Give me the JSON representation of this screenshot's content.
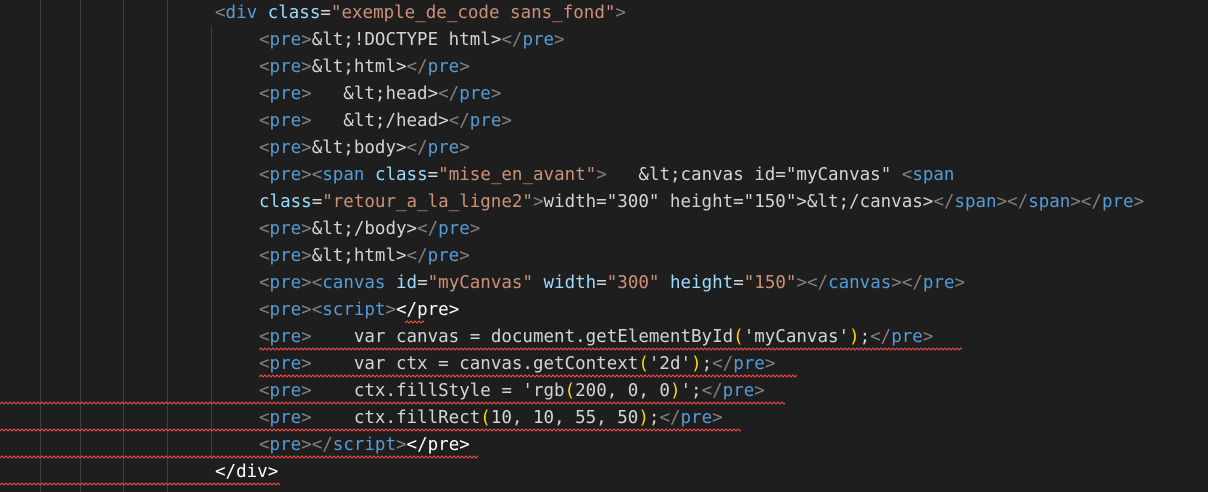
{
  "lines": [
    {
      "indent": 215,
      "tokens": [
        {
          "t": "<",
          "c": "br"
        },
        {
          "t": "div",
          "c": "tag"
        },
        {
          "t": " class",
          "c": "attr"
        },
        {
          "t": "=",
          "c": "txt"
        },
        {
          "t": "\"exemple_de_code sans_fond\"",
          "c": "str"
        },
        {
          "t": ">",
          "c": "br"
        }
      ]
    },
    {
      "indent": 259,
      "tokens": [
        {
          "t": "<",
          "c": "br"
        },
        {
          "t": "pre",
          "c": "tag"
        },
        {
          "t": ">",
          "c": "br"
        },
        {
          "t": "&lt;!DOCTYPE html>",
          "c": "txt"
        },
        {
          "t": "</",
          "c": "br"
        },
        {
          "t": "pre",
          "c": "tag"
        },
        {
          "t": ">",
          "c": "br"
        }
      ]
    },
    {
      "indent": 259,
      "tokens": [
        {
          "t": "<",
          "c": "br"
        },
        {
          "t": "pre",
          "c": "tag"
        },
        {
          "t": ">",
          "c": "br"
        },
        {
          "t": "&lt;html>",
          "c": "txt"
        },
        {
          "t": "</",
          "c": "br"
        },
        {
          "t": "pre",
          "c": "tag"
        },
        {
          "t": ">",
          "c": "br"
        }
      ]
    },
    {
      "indent": 259,
      "tokens": [
        {
          "t": "<",
          "c": "br"
        },
        {
          "t": "pre",
          "c": "tag"
        },
        {
          "t": ">",
          "c": "br"
        },
        {
          "t": "   &lt;head>",
          "c": "txt"
        },
        {
          "t": "</",
          "c": "br"
        },
        {
          "t": "pre",
          "c": "tag"
        },
        {
          "t": ">",
          "c": "br"
        }
      ]
    },
    {
      "indent": 259,
      "tokens": [
        {
          "t": "<",
          "c": "br"
        },
        {
          "t": "pre",
          "c": "tag"
        },
        {
          "t": ">",
          "c": "br"
        },
        {
          "t": "   &lt;/head>",
          "c": "txt"
        },
        {
          "t": "</",
          "c": "br"
        },
        {
          "t": "pre",
          "c": "tag"
        },
        {
          "t": ">",
          "c": "br"
        }
      ]
    },
    {
      "indent": 259,
      "tokens": [
        {
          "t": "<",
          "c": "br"
        },
        {
          "t": "pre",
          "c": "tag"
        },
        {
          "t": ">",
          "c": "br"
        },
        {
          "t": "&lt;body>",
          "c": "txt"
        },
        {
          "t": "</",
          "c": "br"
        },
        {
          "t": "pre",
          "c": "tag"
        },
        {
          "t": ">",
          "c": "br"
        }
      ]
    },
    {
      "indent": 259,
      "tokens": [
        {
          "t": "<",
          "c": "br"
        },
        {
          "t": "pre",
          "c": "tag"
        },
        {
          "t": ">",
          "c": "br"
        },
        {
          "t": "<",
          "c": "br"
        },
        {
          "t": "span",
          "c": "tag"
        },
        {
          "t": " class",
          "c": "attr"
        },
        {
          "t": "=",
          "c": "txt"
        },
        {
          "t": "\"mise_en_avant\"",
          "c": "str"
        },
        {
          "t": ">",
          "c": "br"
        },
        {
          "t": "   &lt;canvas id=\"myCanvas\" ",
          "c": "txt"
        },
        {
          "t": "<",
          "c": "br"
        },
        {
          "t": "span",
          "c": "tag"
        }
      ]
    },
    {
      "indent": 259,
      "tokens": [
        {
          "t": "class",
          "c": "attr"
        },
        {
          "t": "=",
          "c": "txt"
        },
        {
          "t": "\"retour_a_la_ligne2\"",
          "c": "str"
        },
        {
          "t": ">",
          "c": "br"
        },
        {
          "t": "width=\"300\" height=\"150\">&lt;/canvas>",
          "c": "txt"
        },
        {
          "t": "</",
          "c": "br"
        },
        {
          "t": "span",
          "c": "tag"
        },
        {
          "t": ">",
          "c": "br"
        },
        {
          "t": "</",
          "c": "br"
        },
        {
          "t": "span",
          "c": "tag"
        },
        {
          "t": ">",
          "c": "br"
        },
        {
          "t": "</",
          "c": "br"
        },
        {
          "t": "pre",
          "c": "tag"
        },
        {
          "t": ">",
          "c": "br"
        }
      ]
    },
    {
      "indent": 259,
      "tokens": [
        {
          "t": "<",
          "c": "br"
        },
        {
          "t": "pre",
          "c": "tag"
        },
        {
          "t": ">",
          "c": "br"
        },
        {
          "t": "&lt;/body>",
          "c": "txt"
        },
        {
          "t": "</",
          "c": "br"
        },
        {
          "t": "pre",
          "c": "tag"
        },
        {
          "t": ">",
          "c": "br"
        }
      ]
    },
    {
      "indent": 259,
      "tokens": [
        {
          "t": "<",
          "c": "br"
        },
        {
          "t": "pre",
          "c": "tag"
        },
        {
          "t": ">",
          "c": "br"
        },
        {
          "t": "&lt;html>",
          "c": "txt"
        },
        {
          "t": "</",
          "c": "br"
        },
        {
          "t": "pre",
          "c": "tag"
        },
        {
          "t": ">",
          "c": "br"
        }
      ]
    },
    {
      "indent": 259,
      "tokens": [
        {
          "t": "<",
          "c": "br"
        },
        {
          "t": "pre",
          "c": "tag"
        },
        {
          "t": ">",
          "c": "br"
        },
        {
          "t": "<",
          "c": "br"
        },
        {
          "t": "canvas",
          "c": "tag"
        },
        {
          "t": " id",
          "c": "attr"
        },
        {
          "t": "=",
          "c": "txt"
        },
        {
          "t": "\"myCanvas\"",
          "c": "str"
        },
        {
          "t": " width",
          "c": "attr"
        },
        {
          "t": "=",
          "c": "txt"
        },
        {
          "t": "\"300\"",
          "c": "str"
        },
        {
          "t": " height",
          "c": "attr"
        },
        {
          "t": "=",
          "c": "txt"
        },
        {
          "t": "\"150\"",
          "c": "str"
        },
        {
          "t": ">",
          "c": "br"
        },
        {
          "t": "</",
          "c": "br"
        },
        {
          "t": "canvas",
          "c": "tag"
        },
        {
          "t": ">",
          "c": "br"
        },
        {
          "t": "</",
          "c": "br"
        },
        {
          "t": "pre",
          "c": "tag"
        },
        {
          "t": ">",
          "c": "br"
        }
      ]
    },
    {
      "indent": 259,
      "tokens": [
        {
          "t": "<",
          "c": "br"
        },
        {
          "t": "pre",
          "c": "tag"
        },
        {
          "t": ">",
          "c": "br"
        },
        {
          "t": "<",
          "c": "br"
        },
        {
          "t": "script",
          "c": "tag"
        },
        {
          "t": ">",
          "c": "br"
        },
        {
          "t": "</",
          "c": "wht"
        },
        {
          "t": "pre",
          "c": "wht"
        },
        {
          "t": ">",
          "c": "wht"
        }
      ]
    },
    {
      "indent": 259,
      "tokens": [
        {
          "t": "<",
          "c": "br"
        },
        {
          "t": "pre",
          "c": "tag"
        },
        {
          "t": ">",
          "c": "br"
        },
        {
          "t": "    var canvas = document.getElementById",
          "c": "txt"
        },
        {
          "t": "(",
          "c": "par"
        },
        {
          "t": "'myCanvas'",
          "c": "txt"
        },
        {
          "t": ")",
          "c": "par"
        },
        {
          "t": ";",
          "c": "txt"
        },
        {
          "t": "</",
          "c": "br"
        },
        {
          "t": "pre",
          "c": "tag"
        },
        {
          "t": ">",
          "c": "br"
        }
      ]
    },
    {
      "indent": 259,
      "tokens": [
        {
          "t": "<",
          "c": "br"
        },
        {
          "t": "pre",
          "c": "tag"
        },
        {
          "t": ">",
          "c": "br"
        },
        {
          "t": "    var ctx = canvas.getContext",
          "c": "txt"
        },
        {
          "t": "(",
          "c": "par"
        },
        {
          "t": "'2d'",
          "c": "txt"
        },
        {
          "t": ")",
          "c": "par"
        },
        {
          "t": ";",
          "c": "txt"
        },
        {
          "t": "</",
          "c": "br"
        },
        {
          "t": "pre",
          "c": "tag"
        },
        {
          "t": ">",
          "c": "br"
        }
      ]
    },
    {
      "indent": 259,
      "tokens": [
        {
          "t": "<",
          "c": "br"
        },
        {
          "t": "pre",
          "c": "tag"
        },
        {
          "t": ">",
          "c": "br"
        },
        {
          "t": "    ctx.fillStyle = 'rgb",
          "c": "txt"
        },
        {
          "t": "(",
          "c": "par"
        },
        {
          "t": "200, 0, 0",
          "c": "txt"
        },
        {
          "t": ")",
          "c": "par"
        },
        {
          "t": "';",
          "c": "txt"
        },
        {
          "t": "</",
          "c": "br"
        },
        {
          "t": "pre",
          "c": "tag"
        },
        {
          "t": ">",
          "c": "br"
        }
      ]
    },
    {
      "indent": 259,
      "tokens": [
        {
          "t": "<",
          "c": "br"
        },
        {
          "t": "pre",
          "c": "tag"
        },
        {
          "t": ">",
          "c": "br"
        },
        {
          "t": "    ctx.fillRect",
          "c": "txt"
        },
        {
          "t": "(",
          "c": "par"
        },
        {
          "t": "10, 10, 55, 50",
          "c": "txt"
        },
        {
          "t": ")",
          "c": "par"
        },
        {
          "t": ";",
          "c": "txt"
        },
        {
          "t": "</",
          "c": "br"
        },
        {
          "t": "pre",
          "c": "tag"
        },
        {
          "t": ">",
          "c": "br"
        }
      ]
    },
    {
      "indent": 259,
      "tokens": [
        {
          "t": "<",
          "c": "br"
        },
        {
          "t": "pre",
          "c": "tag"
        },
        {
          "t": ">",
          "c": "br"
        },
        {
          "t": "</",
          "c": "br"
        },
        {
          "t": "script",
          "c": "tag"
        },
        {
          "t": ">",
          "c": "br"
        },
        {
          "t": "</",
          "c": "wht"
        },
        {
          "t": "pre",
          "c": "wht"
        },
        {
          "t": ">",
          "c": "wht"
        }
      ]
    },
    {
      "indent": 215,
      "tokens": [
        {
          "t": "</",
          "c": "wht"
        },
        {
          "t": "div",
          "c": "wht"
        },
        {
          "t": ">",
          "c": "wht"
        }
      ]
    }
  ]
}
